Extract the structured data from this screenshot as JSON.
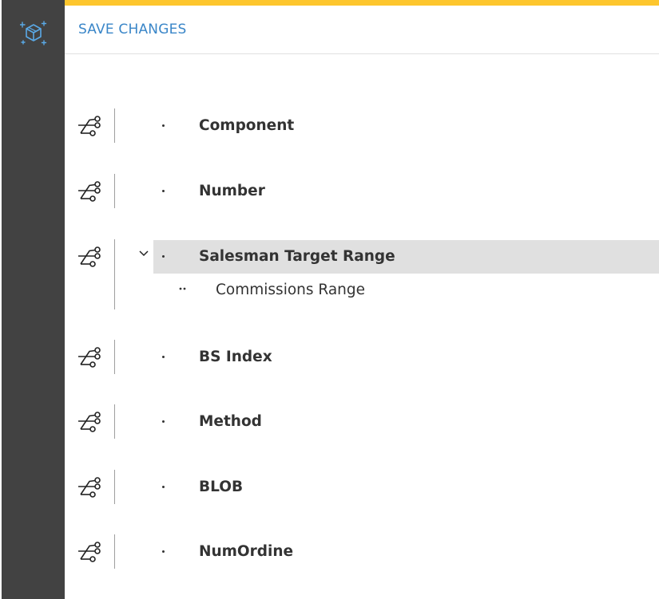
{
  "header": {
    "save_label": "SAVE CHANGES"
  },
  "colors": {
    "accent": "#fdc62d",
    "sidebar": "#424242",
    "link": "#3a86c8",
    "selected_row": "#e0e0e0"
  },
  "sidebar": {
    "logo_icon": "cube-sparkle-icon"
  },
  "tree": {
    "row_icon": "hierarchy-nodes-icon",
    "items": [
      {
        "label": "Component",
        "expanded": false
      },
      {
        "label": "Number",
        "expanded": false
      },
      {
        "label": "Salesman Target Range",
        "expanded": true,
        "selected": true,
        "children": [
          {
            "label": "Commissions Range"
          }
        ]
      },
      {
        "label": "BS Index",
        "expanded": false
      },
      {
        "label": "Method",
        "expanded": false
      },
      {
        "label": "BLOB",
        "expanded": false
      },
      {
        "label": "NumOrdine",
        "expanded": false
      }
    ]
  }
}
